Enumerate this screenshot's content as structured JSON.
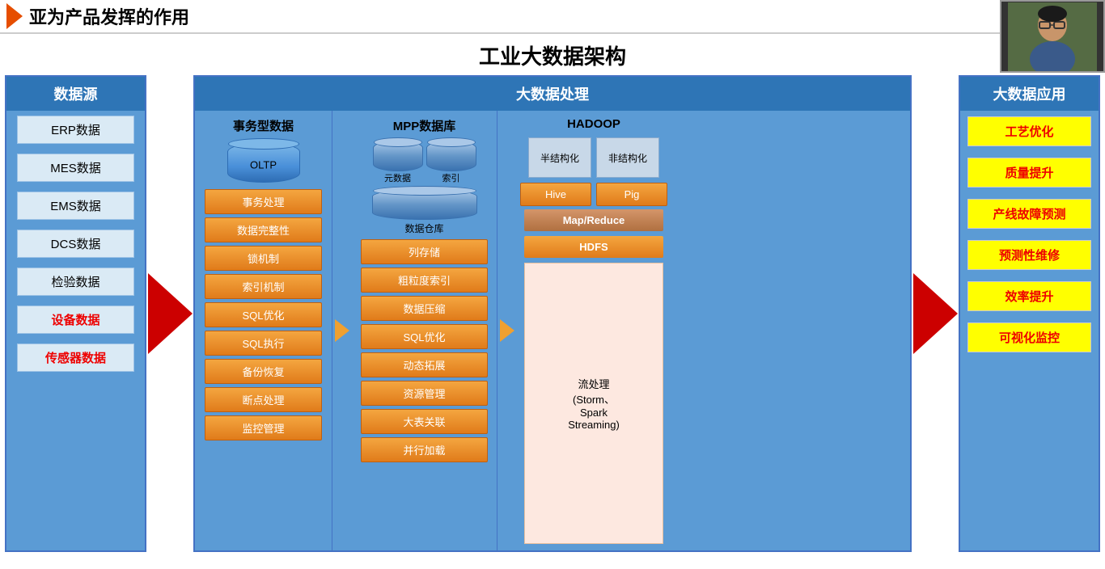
{
  "header": {
    "title": "亚为产品发挥的作用"
  },
  "main_title": "工业大数据架构",
  "datasource": {
    "header": "数据源",
    "items": [
      {
        "label": "ERP数据",
        "red": false
      },
      {
        "label": "MES数据",
        "red": false
      },
      {
        "label": "EMS数据",
        "red": false
      },
      {
        "label": "DCS数据",
        "red": false
      },
      {
        "label": "检验数据",
        "red": false
      },
      {
        "label": "设备数据",
        "red": true
      },
      {
        "label": "传感器数据",
        "red": true
      }
    ]
  },
  "processing": {
    "header": "大数据处理",
    "transactional": {
      "header": "事务型数据",
      "db_label": "OLTP",
      "items": [
        "事务处理",
        "数据完整性",
        "锁机制",
        "索引机制",
        "SQL优化",
        "SQL执行",
        "备份恢复",
        "断点处理",
        "监控管理"
      ]
    },
    "mpp": {
      "header": "MPP数据库",
      "cyl1": "元数据",
      "cyl2": "索引",
      "warehouse": "数据仓库",
      "items": [
        "列存储",
        "粗粒度索引",
        "数据压缩",
        "SQL优化",
        "动态拓展",
        "资源管理",
        "大表关联",
        "并行加载"
      ]
    },
    "hadoop": {
      "header": "HADOOP",
      "box1": "半结构化",
      "box2": "非结构化",
      "hive": "Hive",
      "pig": "Pig",
      "mapreduce": "Map/Reduce",
      "hdfs": "HDFS",
      "stream": "流处理\n(Storm、\nSpark\nStreaming)"
    }
  },
  "application": {
    "header": "大数据应用",
    "items": [
      {
        "label": "工艺优化"
      },
      {
        "label": "质量提升"
      },
      {
        "label": "产线故障预测"
      },
      {
        "label": "预测性维修"
      },
      {
        "label": "效率提升"
      },
      {
        "label": "可视化监控"
      }
    ]
  }
}
